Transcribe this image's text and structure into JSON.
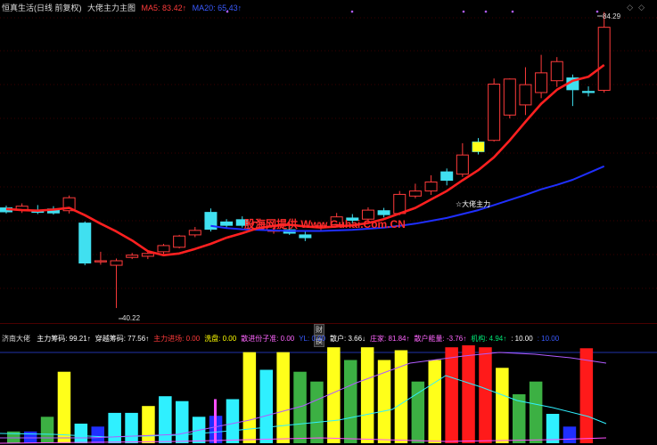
{
  "header": {
    "title": "恒真生活(日线 前复权)",
    "indicator": "大佬主力主图",
    "ma5": "MA5: 83.42↑",
    "ma20": "MA20: 65.43↑"
  },
  "watermark": "股海网提供 Www.Guhai.Com.CN",
  "annotation": "☆大佬主力",
  "price_high": "84.29",
  "price_low": "40.22",
  "markers": [
    "财",
    "换"
  ],
  "sub_header": {
    "name": "济南大佬",
    "items": [
      {
        "label": "主力筹码: 99.21↑",
        "color": "#ffffff"
      },
      {
        "label": "穿越筹码: 77.56↑",
        "color": "#ffffff"
      },
      {
        "label": "主力进场: 0.00",
        "color": "#ff3b3b"
      },
      {
        "label": "洗盘: 0.00",
        "color": "#ffff00"
      },
      {
        "label": "散进份子准: 0.00",
        "color": "#ff66ff"
      },
      {
        "label": "YL: 0.00",
        "color": "#3a5bff"
      },
      {
        "label": "散户: 3.66↓",
        "color": "#ffffff"
      },
      {
        "label": "庄家: 81.84↑",
        "color": "#ff66ff"
      },
      {
        "label": "散户能量: -3.76↑",
        "color": "#ff66ff"
      },
      {
        "label": "机构: 4.94↑",
        "color": "#00e676"
      },
      {
        "label": ": 10.00",
        "color": "#ffffff"
      },
      {
        "label": ": 10.00",
        "color": "#3a5bff"
      }
    ]
  },
  "colors": {
    "up": "#ff3b3b",
    "down": "#40e0f0",
    "ma5": "#ff2020",
    "ma20": "#1f2fff",
    "yellow": "#ffff1a",
    "green": "#3cb043",
    "cyan": "#2ff0ff",
    "blue": "#1f2fff",
    "red": "#ff1a1a"
  },
  "chart_data": {
    "type": "candlestick",
    "candles": [
      {
        "o": 58.0,
        "c": 57.3,
        "h": 58.4,
        "l": 57.0,
        "up": false
      },
      {
        "o": 57.6,
        "c": 58.3,
        "h": 58.8,
        "l": 57.1,
        "up": true
      },
      {
        "o": 57.5,
        "c": 57.2,
        "h": 58.5,
        "l": 56.9,
        "up": false
      },
      {
        "o": 57.8,
        "c": 57.1,
        "h": 58.3,
        "l": 56.8,
        "up": false
      },
      {
        "o": 57.5,
        "c": 59.8,
        "h": 60.2,
        "l": 57.0,
        "up": true
      },
      {
        "o": 55.3,
        "c": 48.2,
        "h": 55.6,
        "l": 47.8,
        "up": false
      },
      {
        "o": 48.6,
        "c": 48.4,
        "h": 50.2,
        "l": 47.9,
        "up": true
      },
      {
        "o": 47.8,
        "c": 48.6,
        "h": 49.0,
        "l": 40.2,
        "up": true
      },
      {
        "o": 49.2,
        "c": 49.6,
        "h": 50.0,
        "l": 48.9,
        "up": true
      },
      {
        "o": 49.4,
        "c": 49.9,
        "h": 50.2,
        "l": 48.9,
        "up": true
      },
      {
        "o": 50.2,
        "c": 51.3,
        "h": 51.6,
        "l": 49.8,
        "up": true
      },
      {
        "o": 51.0,
        "c": 53.0,
        "h": 53.2,
        "l": 50.8,
        "up": true
      },
      {
        "o": 53.2,
        "c": 54.0,
        "h": 54.6,
        "l": 52.8,
        "up": true
      },
      {
        "o": 57.2,
        "c": 54.2,
        "h": 57.9,
        "l": 53.8,
        "up": false
      },
      {
        "o": 55.5,
        "c": 54.9,
        "h": 56.0,
        "l": 54.3,
        "up": false
      },
      {
        "o": 55.9,
        "c": 54.9,
        "h": 56.5,
        "l": 54.5,
        "up": false
      },
      {
        "o": 54.3,
        "c": 55.5,
        "h": 56.1,
        "l": 54.0,
        "up": true
      },
      {
        "o": 53.9,
        "c": 54.0,
        "h": 54.6,
        "l": 53.4,
        "up": true
      },
      {
        "o": 54.1,
        "c": 53.5,
        "h": 55.0,
        "l": 53.2,
        "up": false
      },
      {
        "o": 53.2,
        "c": 52.7,
        "h": 53.8,
        "l": 52.1,
        "up": false
      },
      {
        "o": 54.5,
        "c": 54.8,
        "h": 55.2,
        "l": 54.0,
        "up": true
      },
      {
        "o": 55.0,
        "c": 56.4,
        "h": 57.1,
        "l": 54.8,
        "up": true
      },
      {
        "o": 56.2,
        "c": 55.8,
        "h": 56.9,
        "l": 55.2,
        "up": false
      },
      {
        "o": 56.0,
        "c": 57.6,
        "h": 58.1,
        "l": 55.5,
        "up": true
      },
      {
        "o": 57.5,
        "c": 56.8,
        "h": 58.0,
        "l": 56.3,
        "up": false
      },
      {
        "o": 57.0,
        "c": 60.4,
        "h": 61.0,
        "l": 56.7,
        "up": true
      },
      {
        "o": 60.1,
        "c": 61.0,
        "h": 62.3,
        "l": 59.7,
        "up": true
      },
      {
        "o": 61.0,
        "c": 62.6,
        "h": 63.8,
        "l": 60.3,
        "up": true
      },
      {
        "o": 64.4,
        "c": 62.9,
        "h": 65.0,
        "l": 62.0,
        "up": false
      },
      {
        "o": 64.0,
        "c": 67.4,
        "h": 69.5,
        "l": 63.5,
        "up": true
      },
      {
        "o": 68.0,
        "c": 69.7,
        "h": 70.4,
        "l": 67.5,
        "up": false
      },
      {
        "o": 70.0,
        "c": 80.0,
        "h": 81.0,
        "l": 69.8,
        "up": true
      },
      {
        "o": 74.5,
        "c": 80.9,
        "h": 81.0,
        "l": 73.9,
        "up": true
      },
      {
        "o": 76.3,
        "c": 79.9,
        "h": 83.0,
        "l": 74.5,
        "up": true
      },
      {
        "o": 78.5,
        "c": 82.0,
        "h": 85.2,
        "l": 77.5,
        "up": true
      },
      {
        "o": 80.6,
        "c": 84.0,
        "h": 84.8,
        "l": 79.5,
        "up": true
      },
      {
        "o": 81.1,
        "c": 79.0,
        "h": 81.7,
        "l": 76.1,
        "up": false
      },
      {
        "o": 78.5,
        "c": 78.7,
        "h": 79.6,
        "l": 77.8,
        "up": false
      },
      {
        "o": 78.9,
        "c": 90.1,
        "h": 92.8,
        "l": 78.5,
        "up": true
      }
    ],
    "ma5": [
      57.8,
      57.6,
      57.5,
      57.7,
      58.0,
      56.7,
      55.2,
      53.8,
      52.2,
      50.3,
      49.6,
      49.9,
      50.7,
      51.6,
      52.7,
      53.5,
      54.4,
      54.8,
      55.0,
      54.7,
      54.5,
      54.7,
      54.9,
      55.3,
      56.0,
      57.0,
      58.0,
      59.5,
      61.0,
      62.9,
      64.7,
      67.0,
      70.0,
      73.3,
      76.5,
      79.0,
      80.6,
      81.3,
      83.4
    ],
    "ma20": [
      null,
      null,
      null,
      null,
      null,
      null,
      null,
      null,
      null,
      null,
      null,
      null,
      null,
      54.8,
      54.4,
      54.2,
      54.1,
      54.0,
      53.9,
      53.9,
      53.9,
      54.0,
      54.1,
      54.3,
      54.5,
      54.8,
      55.2,
      55.7,
      56.2,
      56.9,
      57.6,
      58.5,
      59.4,
      60.3,
      61.3,
      62.1,
      63.0,
      64.2,
      65.4
    ],
    "sub_bars": [
      {
        "v": 12,
        "c": "green"
      },
      {
        "v": 12,
        "c": "blue"
      },
      {
        "v": 27,
        "c": "green"
      },
      {
        "v": 73,
        "c": "yellow"
      },
      {
        "v": 20,
        "c": "cyan"
      },
      {
        "v": 17,
        "c": "blue"
      },
      {
        "v": 31,
        "c": "cyan"
      },
      {
        "v": 31,
        "c": "cyan"
      },
      {
        "v": 38,
        "c": "yellow"
      },
      {
        "v": 48,
        "c": "cyan"
      },
      {
        "v": 43,
        "c": "cyan"
      },
      {
        "v": 27,
        "c": "cyan"
      },
      {
        "v": 28,
        "c": "blue"
      },
      {
        "v": 45,
        "c": "cyan"
      },
      {
        "v": 93,
        "c": "yellow"
      },
      {
        "v": 75,
        "c": "cyan"
      },
      {
        "v": 93,
        "c": "yellow"
      },
      {
        "v": 73,
        "c": "green"
      },
      {
        "v": 63,
        "c": "green"
      },
      {
        "v": 98,
        "c": "yellow"
      },
      {
        "v": 85,
        "c": "green"
      },
      {
        "v": 98,
        "c": "yellow"
      },
      {
        "v": 85,
        "c": "yellow"
      },
      {
        "v": 95,
        "c": "yellow"
      },
      {
        "v": 63,
        "c": "green"
      },
      {
        "v": 85,
        "c": "yellow"
      },
      {
        "v": 98,
        "c": "red"
      },
      {
        "v": 100,
        "c": "red"
      },
      {
        "v": 98,
        "c": "red"
      },
      {
        "v": 77,
        "c": "yellow"
      },
      {
        "v": 50,
        "c": "green"
      },
      {
        "v": 63,
        "c": "green"
      },
      {
        "v": 30,
        "c": "cyan"
      },
      {
        "v": 17,
        "c": "blue"
      },
      {
        "v": 97,
        "c": "red"
      }
    ]
  }
}
